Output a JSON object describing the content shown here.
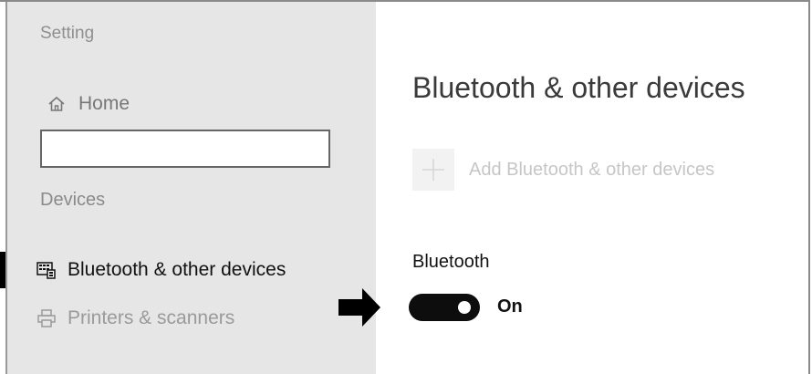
{
  "app_title": "Setting",
  "sidebar": {
    "home": {
      "icon": "home-icon",
      "label": "Home"
    },
    "search": {
      "value": "",
      "placeholder": ""
    },
    "section_label": "Devices",
    "items": [
      {
        "icon": "keyboard-icon",
        "label": "Bluetooth & other devices",
        "selected": true
      },
      {
        "icon": "printer-icon",
        "label": "Printers & scanners",
        "selected": false
      }
    ]
  },
  "main": {
    "title": "Bluetooth & other devices",
    "add_device": {
      "icon": "plus-icon",
      "label": "Add Bluetooth & other devices"
    },
    "bluetooth": {
      "heading": "Bluetooth",
      "toggle_on": true,
      "toggle_state_label": "On"
    },
    "annotation": {
      "icon": "arrow-right-icon"
    }
  },
  "colors": {
    "sidebar_bg": "#e6e6e6",
    "toggle_on_bg": "#0d0d0d",
    "selected_indicator": "#000000",
    "disabled_text": "#c6c6c6"
  }
}
